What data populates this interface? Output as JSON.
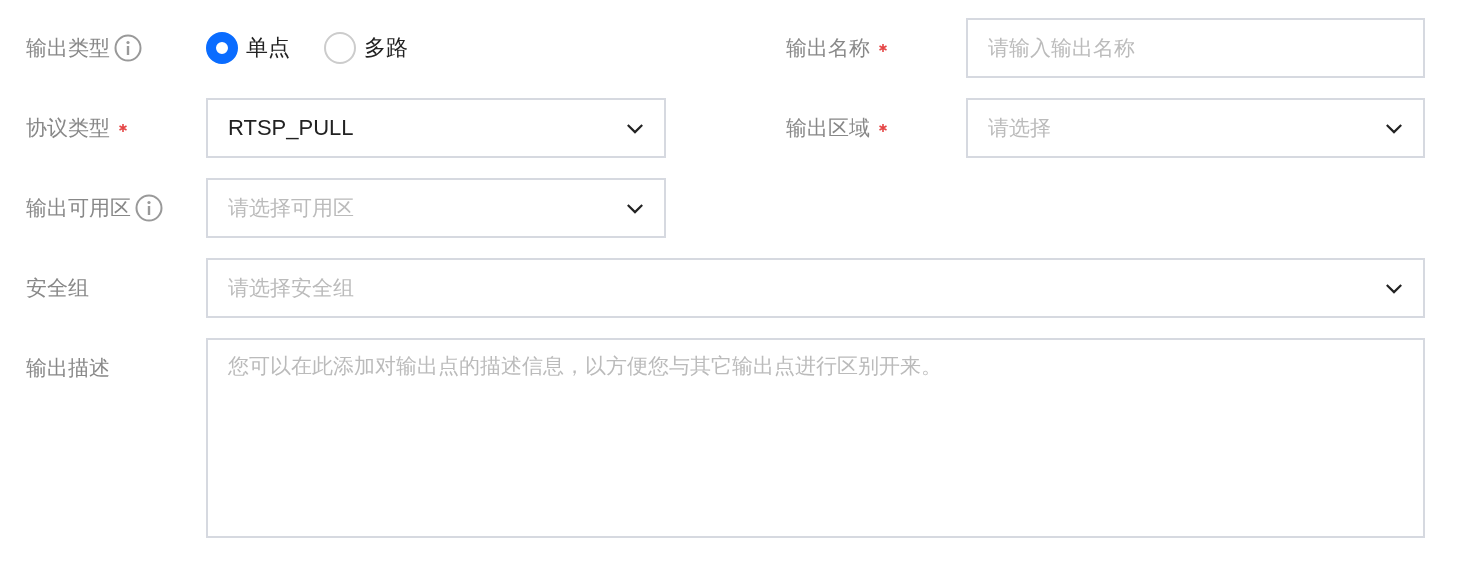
{
  "rows": [
    {
      "cells": [
        {
          "kind": "radio",
          "label": "输出类型",
          "info": true,
          "options": [
            {
              "label": "单点",
              "selected": true
            },
            {
              "label": "多路",
              "selected": false
            }
          ]
        },
        {
          "kind": "input",
          "label": "输出名称",
          "required": true,
          "placeholder": "请输入输出名称"
        }
      ]
    },
    {
      "cells": [
        {
          "kind": "select",
          "label": "协议类型",
          "required": true,
          "value": "RTSP_PULL"
        },
        {
          "kind": "select",
          "label": "输出区域",
          "required": true,
          "placeholder": "请选择"
        }
      ]
    },
    {
      "cells": [
        {
          "kind": "select",
          "label": "输出可用区",
          "info": true,
          "placeholder": "请选择可用区"
        }
      ]
    },
    {
      "cells": [
        {
          "kind": "select",
          "label": "安全组",
          "wide": true,
          "placeholder": "请选择安全组"
        }
      ]
    },
    {
      "cells": [
        {
          "kind": "textarea",
          "label": "输出描述",
          "wide": true,
          "placeholder": "您可以在此添加对输出点的描述信息，以方便您与其它输出点进行区别开来。"
        }
      ]
    }
  ]
}
